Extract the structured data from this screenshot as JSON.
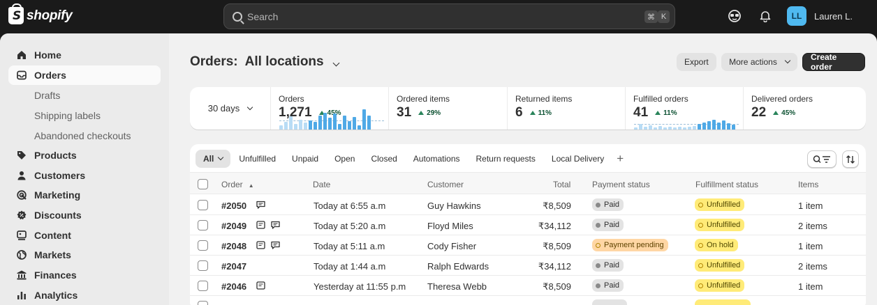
{
  "topbar": {
    "brand": "shopify",
    "search_placeholder": "Search",
    "shortcut_cmd": "⌘",
    "shortcut_key": "K",
    "avatar_initials": "LL",
    "user_name": "Lauren L."
  },
  "sidebar": {
    "items": [
      {
        "label": "Home",
        "icon": "home-icon"
      },
      {
        "label": "Orders",
        "icon": "orders-icon"
      },
      {
        "label": "Products",
        "icon": "tag-icon"
      },
      {
        "label": "Customers",
        "icon": "person-icon"
      },
      {
        "label": "Marketing",
        "icon": "target-icon"
      },
      {
        "label": "Discounts",
        "icon": "discount-icon"
      },
      {
        "label": "Content",
        "icon": "content-icon"
      },
      {
        "label": "Markets",
        "icon": "globe-icon"
      },
      {
        "label": "Finances",
        "icon": "bank-icon"
      },
      {
        "label": "Analytics",
        "icon": "chart-icon"
      }
    ],
    "orders_sub": [
      "Drafts",
      "Shipping labels",
      "Abandoned checkouts"
    ]
  },
  "header": {
    "title": "Orders:",
    "location": "All locations",
    "export_label": "Export",
    "more_actions_label": "More actions",
    "create_label": "Create order"
  },
  "metrics": {
    "period": "30 days",
    "items": [
      {
        "label": "Orders",
        "value": "1,271",
        "change": "45%"
      },
      {
        "label": "Ordered items",
        "value": "31",
        "change": "29%"
      },
      {
        "label": "Returned items",
        "value": "6",
        "change": "11%"
      },
      {
        "label": "Fulfilled orders",
        "value": "41",
        "change": "11%"
      },
      {
        "label": "Delivered orders",
        "value": "22",
        "change": "45%"
      }
    ]
  },
  "orders_table": {
    "tabs": [
      "All",
      "Unfulfilled",
      "Unpaid",
      "Open",
      "Closed",
      "Automations",
      "Return requests",
      "Local Delivery"
    ],
    "add_tab": "+",
    "columns": [
      "Order",
      "Date",
      "Customer",
      "Total",
      "Payment status",
      "Fulfillment status",
      "Items"
    ],
    "rows": [
      {
        "order": "#2050",
        "date": "Today at 6:55 a.m",
        "customer": "Guy Hawkins",
        "total": "₹8,509",
        "payment": "Paid",
        "fulfillment": "Unfulfilled",
        "items": "1 item"
      },
      {
        "order": "#2049",
        "date": "Today at 5:20 a.m",
        "customer": "Floyd Miles",
        "total": "₹34,112",
        "payment": "Paid",
        "fulfillment": "Unfulfilled",
        "items": "2 items"
      },
      {
        "order": "#2048",
        "date": "Today at 5:11 a.m",
        "customer": "Cody Fisher",
        "total": "₹8,509",
        "payment": "Payment pending",
        "fulfillment": "On hold",
        "items": "1 item"
      },
      {
        "order": "#2047",
        "date": "Today at 1:44 a.m",
        "customer": "Ralph Edwards",
        "total": "₹34,112",
        "payment": "Paid",
        "fulfillment": "Unfulfilled",
        "items": "2 items"
      },
      {
        "order": "#2046",
        "date": "Yesterday at 11:55 p.m",
        "customer": "Theresa Webb",
        "total": "₹8,509",
        "payment": "Paid",
        "fulfillment": "Unfulfilled",
        "items": "1 item"
      }
    ]
  }
}
